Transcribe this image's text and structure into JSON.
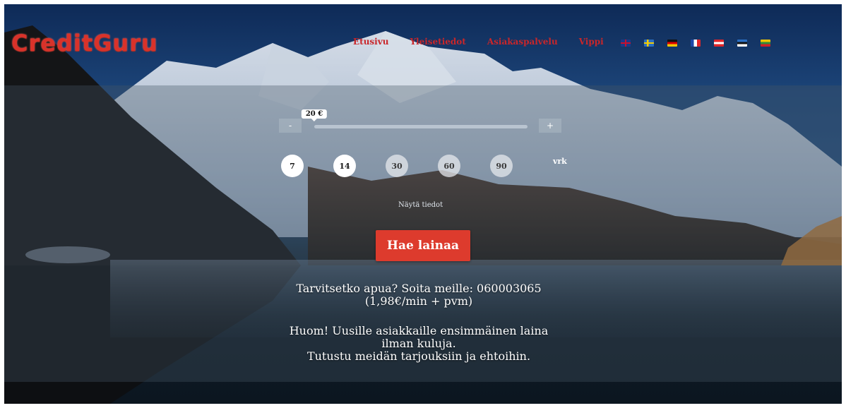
{
  "header": {
    "logo": "CreditGuru",
    "nav": [
      "Etusivu",
      "Yleisetiedot",
      "Asiakaspalvelu",
      "Vippi"
    ],
    "languages": [
      "uk-flag-icon",
      "se-flag-icon",
      "de-flag-icon",
      "fr-flag-icon",
      "at-flag-icon",
      "ee-flag-icon",
      "lt-flag-icon"
    ]
  },
  "loan": {
    "amount_label": "20 €",
    "amount_fraction": 0.0,
    "minus_label": "-",
    "plus_label": "+",
    "days": [
      "7",
      "14",
      "30",
      "60",
      "90"
    ],
    "active_days": [
      "7",
      "14"
    ],
    "days_unit": "vrk",
    "details_link": "Näytä tiedot",
    "apply_button": "Hae lainaa"
  },
  "info": {
    "help_line1": "Tarvitsetko apua? Soita meille: 060003065",
    "help_line2": "(1,98€/min + pvm)",
    "notice_line1": "Huom! Uusille asiakkaille ensimmäinen laina",
    "notice_line2": "ilman kuluja.",
    "notice_line3": "Tutustu meidän tarjouksiin ja ehtoihin."
  },
  "colors": {
    "brand_red": "#d9322a",
    "button_red": "#dd3b2d",
    "sky_dark": "#0e2a57",
    "water_dark": "#0c1620"
  }
}
